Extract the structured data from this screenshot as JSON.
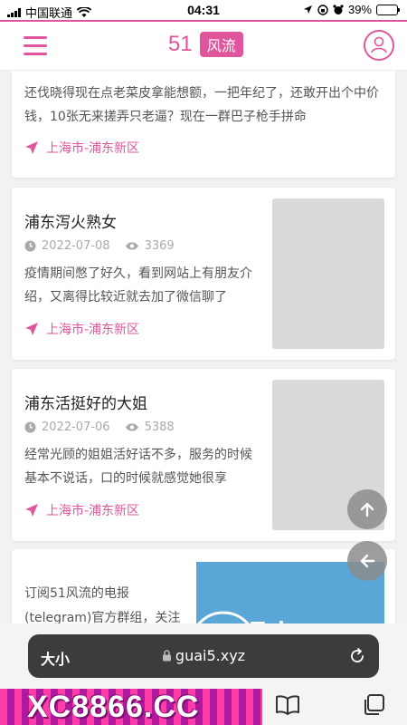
{
  "status_bar": {
    "carrier": "中国联通",
    "time": "04:31",
    "battery": "39%",
    "battery_level": 0.39
  },
  "header": {
    "brand_number": "51",
    "brand_tag": "风流"
  },
  "cards": [
    {
      "excerpt": "还伐晓得现在点老菜皮拿能想额，一把年纪了，还敢开出个中价钱，10张无来搓弄只老逼？现在一群巴子枪手拼命",
      "location": "上海市-浦东新区"
    },
    {
      "title": "浦东泻火熟女",
      "date": "2022-07-08",
      "views": "3369",
      "excerpt": "疫情期间憋了好久，看到网站上有朋友介绍，又离得比较近就去加了微信聊了",
      "location": "上海市-浦东新区"
    },
    {
      "title": "浦东活挺好的大姐",
      "date": "2022-07-06",
      "views": "5388",
      "excerpt": "经常光顾的姐姐活好话不多，服务的时候基本不说话，口的时候就感觉她很享",
      "location": "上海市-浦东新区"
    },
    {
      "excerpt": "订阅51风流的电报(telegram)官方群组，关注",
      "banner_word": "Telegram"
    }
  ],
  "browser": {
    "aa_label": "大小",
    "url": "guai5.xyz"
  },
  "ad_banner": {
    "text": "XC8866.CC"
  },
  "colors": {
    "accent": "#e0559c",
    "telegram_blue": "#5aa6d6"
  },
  "icons": [
    "menu-icon",
    "user-icon",
    "clock-icon",
    "eye-icon",
    "location-arrow-icon",
    "arrow-up-icon",
    "arrow-left-icon",
    "lock-icon",
    "reload-icon",
    "book-icon",
    "tabs-icon"
  ]
}
